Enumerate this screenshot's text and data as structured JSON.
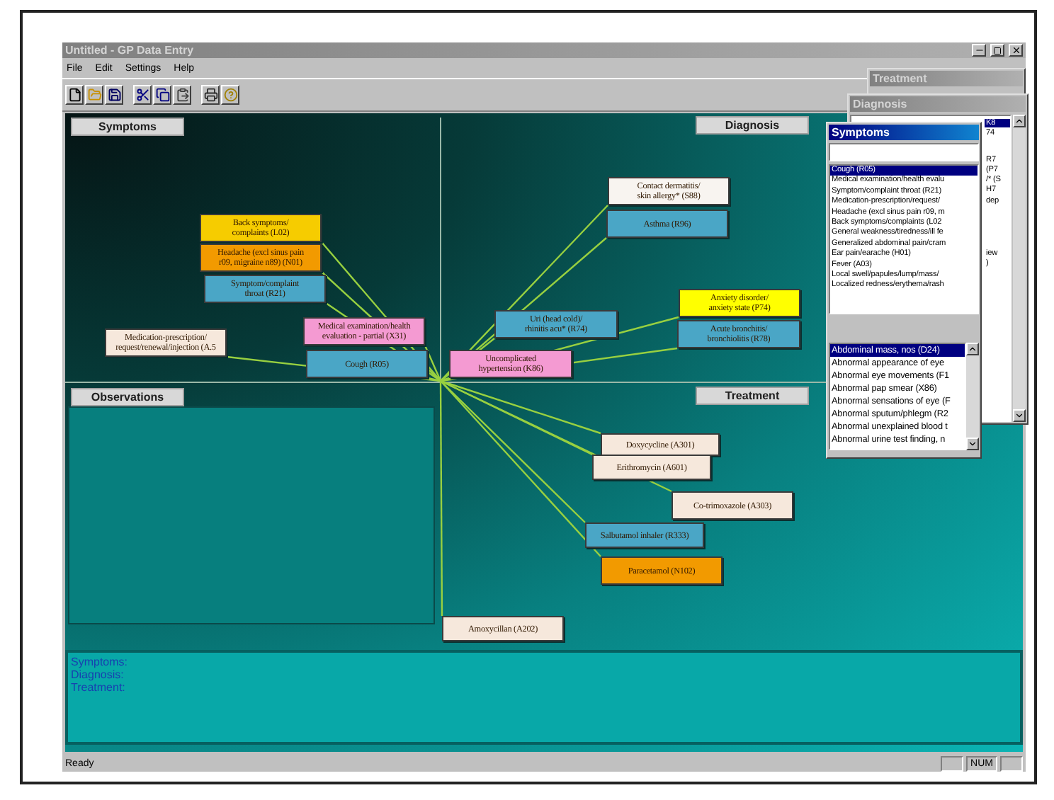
{
  "window": {
    "title": "Untitled - GP Data Entry",
    "active": false
  },
  "menu": [
    {
      "label": "File"
    },
    {
      "label": "Edit"
    },
    {
      "label": "Settings"
    },
    {
      "label": "Help"
    }
  ],
  "toolbar": [
    {
      "kind": "new"
    },
    {
      "kind": "open"
    },
    {
      "kind": "save"
    },
    {
      "kind": "separator"
    },
    {
      "kind": "cut"
    },
    {
      "kind": "copy"
    },
    {
      "kind": "paste"
    },
    {
      "kind": "separator"
    },
    {
      "kind": "print"
    },
    {
      "kind": "help"
    }
  ],
  "canvas": {
    "sections": [
      {
        "label": "Symptoms",
        "kind": "left"
      },
      {
        "label": "Diagnosis",
        "kind": "right"
      },
      {
        "label": "Observations",
        "kind": "left"
      },
      {
        "label": "Treatment",
        "kind": "right"
      }
    ],
    "nodes": [
      {
        "lines": [
          "Back symptoms/",
          "complaints  (L02)"
        ],
        "color": "#f6cc00"
      },
      {
        "lines": [
          "Headache (excl sinus pain",
          "r09, migraine n89) (N01)"
        ],
        "color": "#f29a00"
      },
      {
        "lines": [
          "Symptom/complaint",
          "throat (R21)"
        ],
        "color": "#4aa6c6"
      },
      {
        "lines": [
          "Medication-prescription/",
          "request/renewal/injection (A.5"
        ],
        "color": "#f6e8dc"
      },
      {
        "lines": [
          "Medical examination/health",
          "evaluation - partial (X31)"
        ],
        "color": "#f49ad2"
      },
      {
        "lines": [
          "Cough (R05)"
        ],
        "color": "#4aa6c6"
      },
      {
        "lines": [
          "Uncomplicated",
          "hypertension (K86)"
        ],
        "color": "#f49ad2"
      },
      {
        "lines": [
          "Uri (head cold)/",
          "rhinitis acu* (R74)"
        ],
        "color": "#4aa6c6"
      },
      {
        "lines": [
          "Contact dermatitis/",
          "skin allergy* (S88)"
        ],
        "color": "#f8f4f0"
      },
      {
        "lines": [
          "Asthma (R96)"
        ],
        "color": "#4aa6c6"
      },
      {
        "lines": [
          "Anxiety disorder/",
          "anxiety state (P74)"
        ],
        "color": "#ffff00"
      },
      {
        "lines": [
          "Acute bronchitis/",
          "bronchiolitis (R78)"
        ],
        "color": "#4aa6c6"
      },
      {
        "lines": [
          "Doxycycline (A301)"
        ],
        "color": "#f6e8dc"
      },
      {
        "lines": [
          "Erithromycin (A601)"
        ],
        "color": "#f6e8dc"
      },
      {
        "lines": [
          "Co-trimoxazole (A303)"
        ],
        "color": "#f6e8dc"
      },
      {
        "lines": [
          "Salbutamol inhaler (R333)"
        ],
        "color": "#4aa6c6"
      },
      {
        "lines": [
          "Paracetamol (N102)"
        ],
        "color": "#f29a00"
      },
      {
        "lines": [
          "Amoxycillan (A202)"
        ],
        "color": "#f6e8dc"
      }
    ],
    "summary": [
      "Symptoms:",
      "Diagnosis:",
      "Treatment:"
    ]
  },
  "windows": [
    {
      "title": "Treatment",
      "active": false
    },
    {
      "title": "Diagnosis",
      "active": false,
      "items": [
        {
          "text": "K8",
          "selected": true
        },
        {
          "text": "74",
          "selected": false
        },
        {
          "text": "R7",
          "selected": false
        },
        {
          "text": "(P7",
          "selected": false
        },
        {
          "text": "/* (S",
          "selected": false
        },
        {
          "text": "H7",
          "selected": false
        },
        {
          "text": "dep",
          "selected": false
        },
        {
          "text": "iew",
          "selected": false
        },
        {
          "text": ")",
          "selected": false
        }
      ]
    },
    {
      "title": "Symptoms",
      "active": true,
      "lists": [
        [
          {
            "text": "Cough (R05)",
            "selected": true
          },
          {
            "text": "Medical examination/health evalu",
            "selected": false
          },
          {
            "text": "Symptom/complaint throat (R21)",
            "selected": false
          },
          {
            "text": "Medication-prescription/request/",
            "selected": false
          },
          {
            "text": "Headache (excl sinus pain r09, m",
            "selected": false
          },
          {
            "text": "Back symptoms/complaints  (L02",
            "selected": false
          },
          {
            "text": "General weakness/tiredness/ill fe",
            "selected": false
          },
          {
            "text": "Generalized abdominal pain/cram",
            "selected": false
          },
          {
            "text": "Ear pain/earache  (H01)",
            "selected": false
          },
          {
            "text": "Fever  (A03)",
            "selected": false
          },
          {
            "text": "Local swell/papules/lump/mass/",
            "selected": false
          },
          {
            "text": "Localized redness/erythema/rash",
            "selected": false
          }
        ],
        [
          {
            "text": "Abdominal mass, nos (D24)",
            "selected": true
          },
          {
            "text": "Abnormal appearance of eye",
            "selected": false
          },
          {
            "text": "Abnormal eye movements (F1",
            "selected": false
          },
          {
            "text": "Abnormal pap smear  (X86)",
            "selected": false
          },
          {
            "text": "Abnormal sensations of eye (F",
            "selected": false
          },
          {
            "text": "Abnormal sputum/phlegm (R2",
            "selected": false
          },
          {
            "text": "Abnormal unexplained blood t",
            "selected": false
          },
          {
            "text": "Abnormal urine test finding, n",
            "selected": false
          }
        ]
      ]
    }
  ],
  "status_bar": {
    "text": "Ready",
    "indicator": "NUM"
  }
}
